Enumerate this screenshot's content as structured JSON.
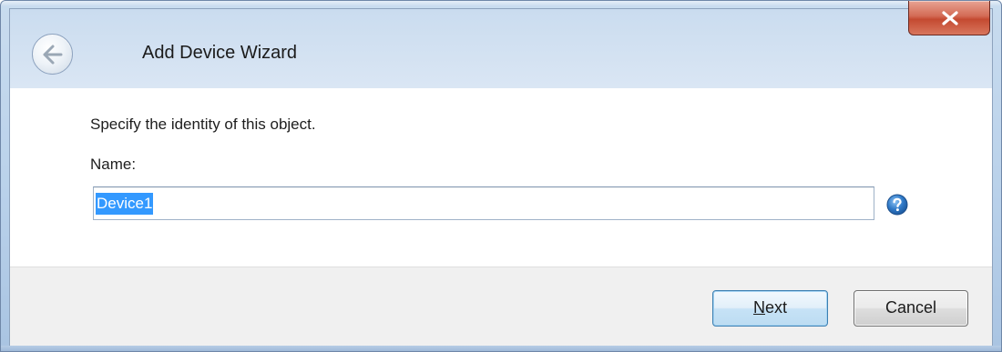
{
  "window": {
    "title": "Add Device Wizard",
    "icons": {
      "back": "back-arrow-icon",
      "close": "close-x-icon",
      "help": "help-question-icon"
    }
  },
  "content": {
    "prompt": "Specify the identity of this object.",
    "name_label": "Name:",
    "name_value": "Device1"
  },
  "footer": {
    "next_mnemonic": "N",
    "next_rest": "ext",
    "cancel_label": "Cancel"
  },
  "colors": {
    "frame": "#b9d1ea",
    "selection": "#3399ff",
    "close_button": "#c44a31",
    "help_icon": "#2f79c7"
  }
}
